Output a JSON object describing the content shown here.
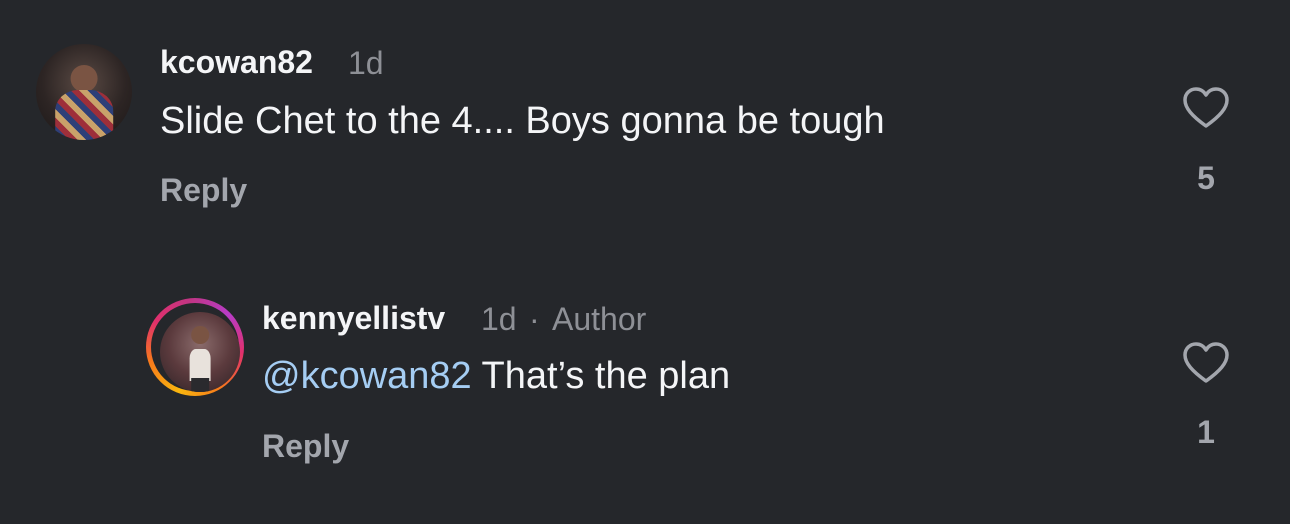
{
  "comments": [
    {
      "username": "kcowan82",
      "time": "1d",
      "text": "Slide Chet to the 4.... Boys gonna be tough",
      "reply_label": "Reply",
      "likes": "5"
    }
  ],
  "replies": [
    {
      "username": "kennyellistv",
      "time": "1d",
      "separator": "·",
      "author_badge": "Author",
      "mention": "@kcowan82",
      "text": " That’s the plan",
      "reply_label": "Reply",
      "likes": "1",
      "has_story_ring": true
    }
  ],
  "icons": {
    "like": "heart-outline-icon"
  },
  "colors": {
    "background": "#25272b",
    "mention": "#a5cdf3",
    "secondary_text": "#8e9096"
  }
}
